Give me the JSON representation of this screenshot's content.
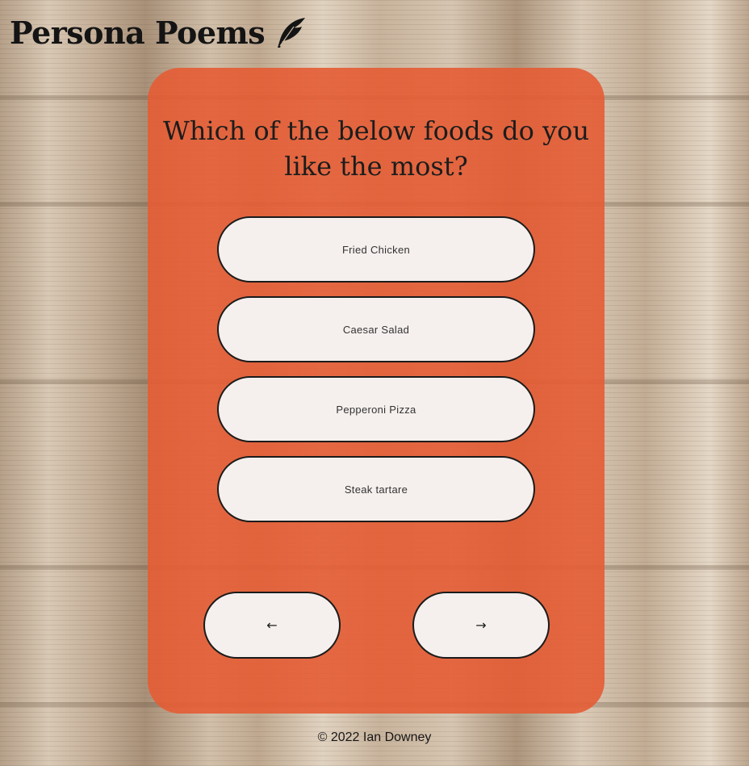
{
  "header": {
    "title": "Persona Poems",
    "icon": "feather-icon"
  },
  "quiz": {
    "question": "Which of the below foods do you like the most?",
    "options": [
      {
        "label": "Fried Chicken"
      },
      {
        "label": "Caesar Salad"
      },
      {
        "label": "Pepperoni Pizza"
      },
      {
        "label": "Steak tartare"
      }
    ],
    "nav": {
      "back_label": "←",
      "next_label": "→"
    }
  },
  "footer": {
    "text": "© 2022 Ian Downey"
  },
  "colors": {
    "card": "#e45c34",
    "button_bg": "#f6f6f6",
    "border": "#1b1b1b"
  }
}
